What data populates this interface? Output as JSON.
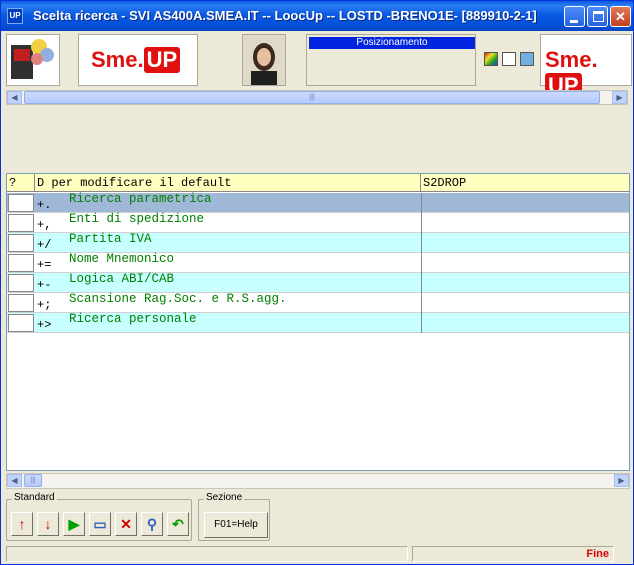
{
  "window": {
    "icon_text": "UP",
    "title": "Scelta ricerca - SVI AS400A.SMEA.IT -- LoocUp -- LOSTD -BRENO1E- [889910-2-1]",
    "minimize": "_",
    "maximize": "□",
    "close": "✕"
  },
  "header": {
    "logo_sme": "Sme.",
    "logo_up": "UP",
    "position_label": "Posizionamento"
  },
  "scroll": {
    "left_arrow": "◀",
    "right_arrow": "▶",
    "grip": "|||"
  },
  "table": {
    "columns": [
      "?",
      "D per modificare il default",
      "S2DROP"
    ],
    "rows": [
      {
        "code": "+.",
        "desc": "Ricerca parametrica",
        "style": "sel"
      },
      {
        "code": "+,",
        "desc": "Enti di spedizione",
        "style": "plain"
      },
      {
        "code": "+/",
        "desc": "Partita IVA",
        "style": "alt"
      },
      {
        "code": "+=",
        "desc": "Nome Mnemonico",
        "style": "plain"
      },
      {
        "code": "+-",
        "desc": "Logica ABI/CAB",
        "style": "alt"
      },
      {
        "code": "+;",
        "desc": "Scansione Rag.Soc. e R.S.agg.",
        "style": "plain"
      },
      {
        "code": "+>",
        "desc": "Ricerca personale",
        "style": "alt"
      }
    ]
  },
  "toolbar": {
    "standard_label": "Standard",
    "sezione_label": "Sezione",
    "help_button": "F01=Help",
    "icons": [
      {
        "name": "arrow-up-icon",
        "glyph": "↑",
        "color": "#d00000"
      },
      {
        "name": "arrow-down-icon",
        "glyph": "↓",
        "color": "#d00000"
      },
      {
        "name": "play-icon",
        "glyph": "▶",
        "color": "#00a000"
      },
      {
        "name": "eraser-icon",
        "glyph": "▭",
        "color": "#3060c0"
      },
      {
        "name": "delete-icon",
        "glyph": "✕",
        "color": "#d00000"
      },
      {
        "name": "search-icon",
        "glyph": "⚲",
        "color": "#3060c0"
      },
      {
        "name": "back-icon",
        "glyph": "↶",
        "color": "#00a000"
      }
    ]
  },
  "status": {
    "text": "Fine"
  }
}
